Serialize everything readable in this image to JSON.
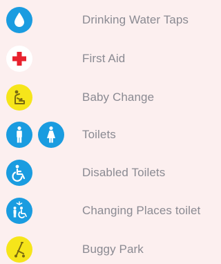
{
  "colors": {
    "background": "#fcefef",
    "blue": "#1a9ce0",
    "red": "#e8222e",
    "yellow": "#f6e51a",
    "label": "#8a8a92"
  },
  "legend": {
    "items": [
      {
        "label": "Drinking Water Taps",
        "icons": [
          "water-drop-icon"
        ]
      },
      {
        "label": "First Aid",
        "icons": [
          "first-aid-cross-icon"
        ]
      },
      {
        "label": "Baby Change",
        "icons": [
          "baby-change-icon"
        ]
      },
      {
        "label": "Toilets",
        "icons": [
          "male-toilet-icon",
          "female-toilet-icon"
        ]
      },
      {
        "label": "Disabled Toilets",
        "icons": [
          "wheelchair-icon"
        ]
      },
      {
        "label": "Changing Places toilet",
        "icons": [
          "changing-places-icon"
        ]
      },
      {
        "label": "Buggy Park",
        "icons": [
          "buggy-icon"
        ]
      }
    ]
  }
}
